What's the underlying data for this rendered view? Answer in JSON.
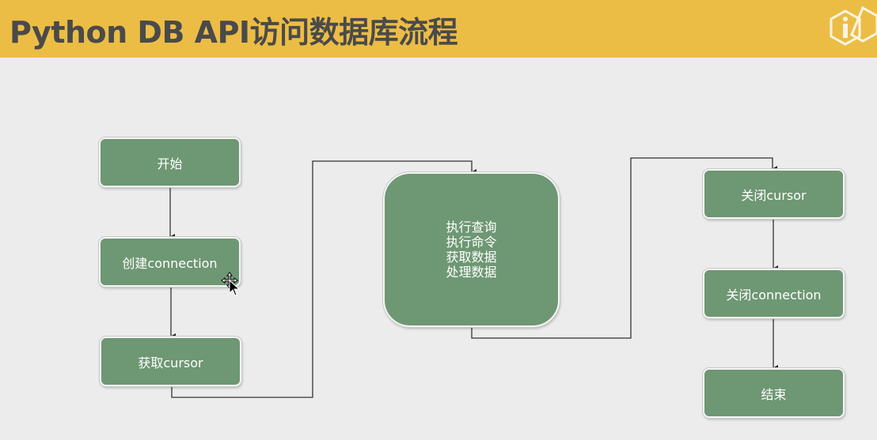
{
  "header": {
    "title": "Python DB API访问数据库流程"
  },
  "nodes": {
    "start": "开始",
    "create_connection": "创建connection",
    "get_cursor": "获取cursor",
    "process": [
      "执行查询",
      "执行命令",
      "获取数据",
      "处理数据"
    ],
    "close_cursor": "关闭cursor",
    "close_connection": "关闭connection",
    "end": "结束"
  },
  "colors": {
    "header_bg": "#ecbd45",
    "node_fill": "#6e9773",
    "page_bg": "#ececec"
  }
}
